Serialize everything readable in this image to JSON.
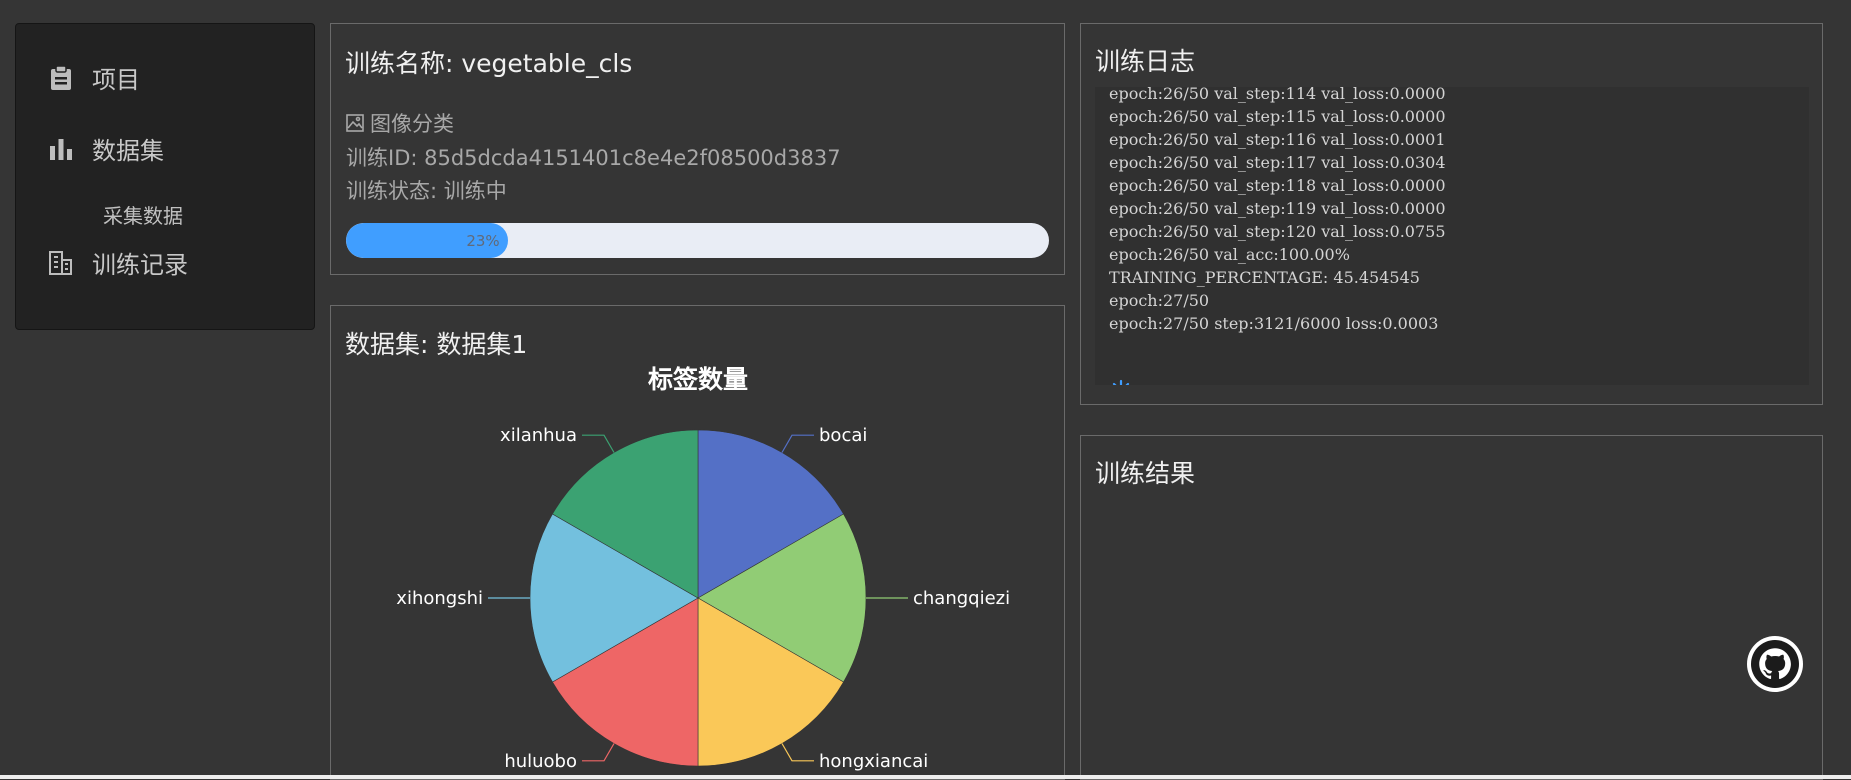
{
  "sidebar": {
    "items": [
      {
        "label": "项目",
        "icon": "clipboard-icon"
      },
      {
        "label": "数据集",
        "icon": "bar-chart-icon"
      },
      {
        "label": "训练记录",
        "icon": "building-icon"
      }
    ],
    "sub_item": "采集数据"
  },
  "training": {
    "title": "训练名称: vegetable_cls",
    "type_label": "图像分类",
    "id_line": "训练ID:  85d5dcda4151401c8e4e2f08500d3837",
    "status_line": "训练状态:  训练中",
    "progress": 23,
    "progress_text": "23%"
  },
  "dataset": {
    "title": "数据集:  数据集1"
  },
  "chart_data": {
    "type": "pie",
    "title": "标签数量",
    "categories": [
      "bocai",
      "changqiezi",
      "hongxiancai",
      "huluobo",
      "xihongshi",
      "xilanhua"
    ],
    "values": [
      1,
      1,
      1,
      1,
      1,
      1
    ],
    "colors": [
      "#5470c6",
      "#91cc75",
      "#fac858",
      "#ee6666",
      "#73c0de",
      "#3ba272"
    ]
  },
  "log": {
    "title": "训练日志",
    "lines": [
      "epoch:26/50 val_step:114 val_loss:0.0000",
      "epoch:26/50 val_step:115 val_loss:0.0000",
      "epoch:26/50 val_step:116 val_loss:0.0001",
      "epoch:26/50 val_step:117 val_loss:0.0304",
      "epoch:26/50 val_step:118 val_loss:0.0000",
      "epoch:26/50 val_step:119 val_loss:0.0000",
      "epoch:26/50 val_step:120 val_loss:0.0755",
      "epoch:26/50 val_acc:100.00%",
      "TRAINING_PERCENTAGE: 45.454545",
      "epoch:27/50",
      "epoch:27/50 step:3121/6000 loss:0.0003"
    ]
  },
  "result": {
    "title": "训练结果"
  },
  "colors": {
    "accent": "#409eff",
    "background": "#353535"
  }
}
